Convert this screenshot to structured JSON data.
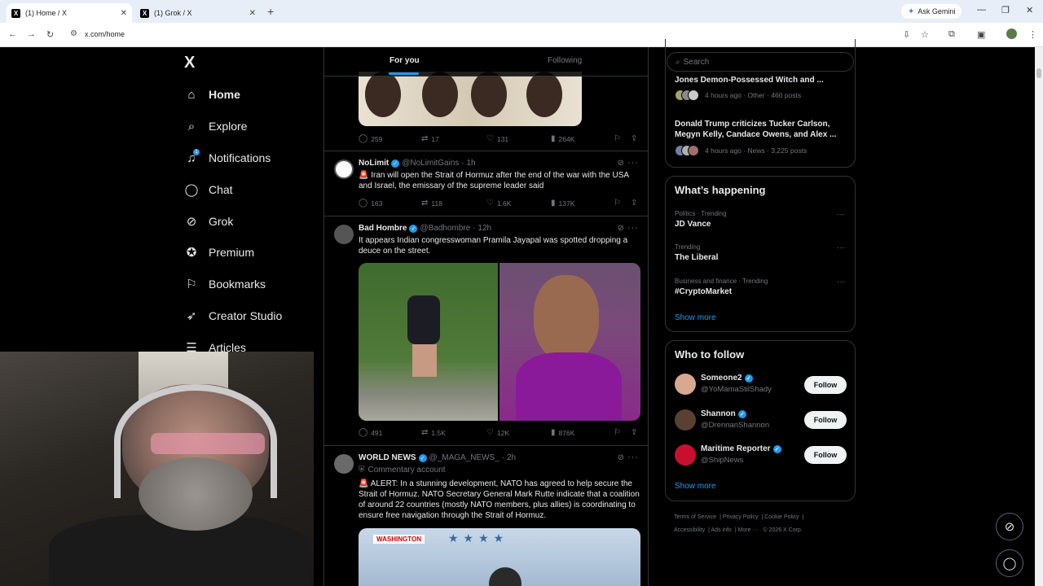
{
  "browser": {
    "tabs": [
      {
        "title": "(1) Home / X",
        "active": true
      },
      {
        "title": "(1) Grok / X",
        "active": false
      }
    ],
    "new_tab": "+",
    "ask_gemini": "Ask Gemini",
    "url": "x.com/home"
  },
  "sidebar": {
    "logo": "X",
    "items": [
      {
        "label": "Home",
        "icon": "home-icon"
      },
      {
        "label": "Explore",
        "icon": "search-icon"
      },
      {
        "label": "Notifications",
        "icon": "bell-icon",
        "badge": "1"
      },
      {
        "label": "Chat",
        "icon": "chat-icon"
      },
      {
        "label": "Grok",
        "icon": "grok-icon"
      },
      {
        "label": "Premium",
        "icon": "premium-icon"
      },
      {
        "label": "Bookmarks",
        "icon": "bookmark-icon"
      },
      {
        "label": "Creator Studio",
        "icon": "rocket-icon"
      },
      {
        "label": "Articles",
        "icon": "article-icon"
      }
    ]
  },
  "feed": {
    "tabs": {
      "for_you": "For you",
      "following": "Following"
    },
    "post0": {
      "replies": "259",
      "reposts": "17",
      "likes": "131",
      "views": "264K"
    },
    "post1": {
      "name": "NoLimit",
      "handle": "@NoLimitGains",
      "time": "· 1h",
      "text": "🚨 Iran will open the Strait of Hormuz after the end of the war with the USA and Israel, the emissary of the supreme leader said",
      "replies": "163",
      "reposts": "118",
      "likes": "1.6K",
      "views": "137K"
    },
    "post2": {
      "name": "Bad Hombre",
      "handle": "@Badhombre",
      "time": "· 12h",
      "text": "It appears Indian congresswoman Pramila Jayapal was spotted dropping a deuce on the street.",
      "replies": "491",
      "reposts": "1.5K",
      "likes": "12K",
      "views": "876K"
    },
    "post3": {
      "name": "WORLD NEWS",
      "handle": "@_MAGA_NEWS_",
      "time": "· 2h",
      "commentary": "Commentary account",
      "text": "🚨 ALERT: In a stunning development, NATO has agreed to help secure the Strait of Hormuz. NATO Secretary General Mark Rutte indicate that a coalition of around 22 countries (mostly NATO members, plus allies) is coordinating to ensure free navigation through the Strait of Hormuz.",
      "media_label": "WASHINGTON"
    }
  },
  "rail": {
    "search_placeholder": "Search",
    "news": [
      {
        "title": "Jones Demon-Possessed Witch and ...",
        "meta": "4 hours ago · Other · 460 posts"
      },
      {
        "title": "Donald Trump criticizes Tucker Carlson, Megyn Kelly, Candace Owens, and Alex ...",
        "meta": "4 hours ago · News · 3,225 posts"
      }
    ],
    "whats_happening": {
      "title": "What’s happening",
      "trends": [
        {
          "meta": "Politics · Trending",
          "name": "JD Vance"
        },
        {
          "meta": "Trending",
          "name": "The Liberal"
        },
        {
          "meta": "Business and finance · Trending",
          "name": "#CryptoMarket"
        }
      ],
      "show_more": "Show more"
    },
    "who_to_follow": {
      "title": "Who to follow",
      "users": [
        {
          "name": "Someone2",
          "handle": "@YoMamaStilShady",
          "button": "Follow"
        },
        {
          "name": "Shannon",
          "handle": "@DrennanShannon",
          "button": "Follow"
        },
        {
          "name": "Maritime Reporter",
          "handle": "@ShipNews",
          "button": "Follow"
        }
      ],
      "show_more": "Show more"
    },
    "footer": {
      "links": [
        "Terms of Service",
        "Privacy Policy",
        "Cookie Policy",
        "Accessibility",
        "Ads info",
        "More ···"
      ],
      "copyright": "© 2026 X Corp."
    }
  },
  "colors": {
    "accent": "#1d9bf0",
    "background": "#000000",
    "text": "#e7e9ea",
    "muted": "#71767b"
  }
}
